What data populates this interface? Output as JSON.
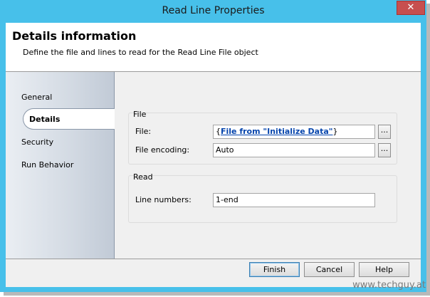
{
  "window": {
    "title": "Read Line Properties",
    "close_glyph": "✕"
  },
  "header": {
    "title": "Details information",
    "subtitle": "Define the file and lines to read for the Read Line File object"
  },
  "nav": {
    "items": [
      {
        "label": "General",
        "selected": false
      },
      {
        "label": "Details",
        "selected": true
      },
      {
        "label": "Security",
        "selected": false
      },
      {
        "label": "Run Behavior",
        "selected": false
      }
    ]
  },
  "file_group": {
    "title": "File",
    "file_label": "File:",
    "file_value_prefix": "{",
    "file_value_link": "File from \"Initialize Data\"",
    "file_value_suffix": "}",
    "encoding_label": "File encoding:",
    "encoding_value": "Auto",
    "browse_label": "..."
  },
  "read_group": {
    "title": "Read",
    "line_numbers_label": "Line numbers:",
    "line_numbers_value": "1-end"
  },
  "footer": {
    "finish": "Finish",
    "cancel": "Cancel",
    "help": "Help"
  },
  "watermark": "www.techguy.at"
}
